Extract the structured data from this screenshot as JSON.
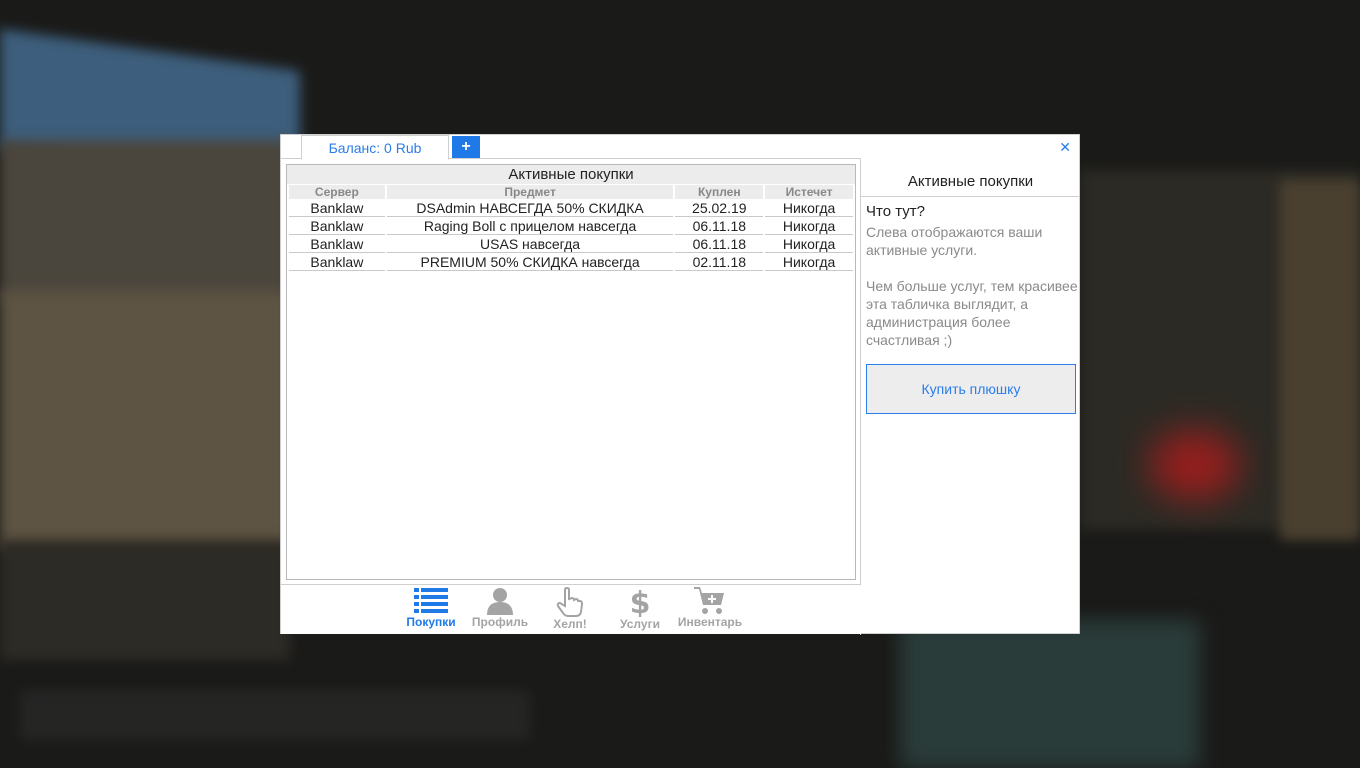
{
  "topbar": {
    "balance_label": "Баланс: 0 Rub",
    "add_label": "+"
  },
  "purchases_panel": {
    "title": "Активные покупки",
    "columns": [
      "Сервер",
      "Предмет",
      "Куплен",
      "Истечет"
    ],
    "rows": [
      [
        "Banklaw",
        "DSAdmin НАВСЕГДА 50% СКИДКА",
        "25.02.19",
        "Никогда"
      ],
      [
        "Banklaw",
        "Raging Boll с прицелом навсегда",
        "06.11.18",
        "Никогда"
      ],
      [
        "Banklaw",
        "USAS навсегда",
        "06.11.18",
        "Никогда"
      ],
      [
        "Banklaw",
        "PREMIUM 50% СКИДКА навсегда",
        "02.11.18",
        "Никогда"
      ]
    ]
  },
  "info_panel": {
    "title": "Активные покупки",
    "question": "Что тут?",
    "text1": "Слева отображаются ваши активные услуги.",
    "text2": "Чем больше услуг, тем красивее эта табличка выглядит, а администрация более счастливая ;)",
    "buy_button": "Купить плюшку"
  },
  "nav": {
    "items": [
      {
        "label": "Покупки",
        "icon": "list-icon",
        "active": true
      },
      {
        "label": "Профиль",
        "icon": "user-icon",
        "active": false
      },
      {
        "label": "Хелп!",
        "icon": "hand-pointer-icon",
        "active": false
      },
      {
        "label": "Услуги",
        "icon": "dollar-icon",
        "active": false
      },
      {
        "label": "Инвентарь",
        "icon": "cart-plus-icon",
        "active": false
      }
    ]
  },
  "colors": {
    "accent": "#1f7ae8",
    "nav_inactive": "#a4a4a4"
  }
}
